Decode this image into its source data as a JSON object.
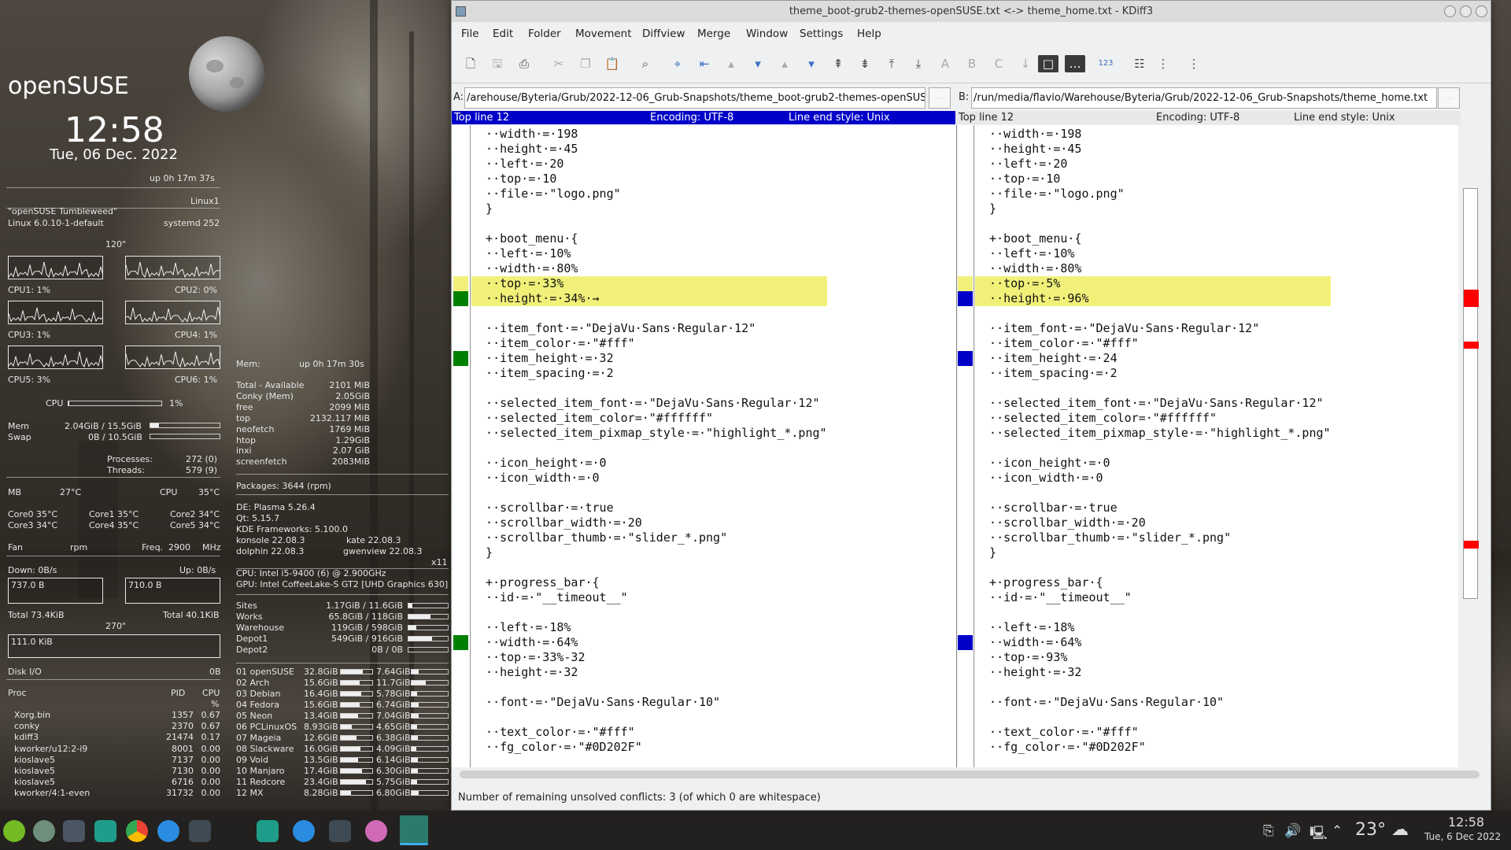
{
  "desktop": {
    "distro": "openSUSE",
    "clock": "12:58",
    "date": "Tue, 06 Dec. 2022",
    "uptime": "up  0h 17m 37s",
    "hostname": "Linux1",
    "os_name": "\"openSUSE Tumbleweed\"",
    "kernel": "Linux 6.0.10-1-default",
    "systemd": "systemd 252",
    "cpu_graph_label": "120\"",
    "cpus": [
      {
        "l": "CPU1: 1%",
        "r": "CPU2: 0%"
      },
      {
        "l": "CPU3: 1%",
        "r": "CPU4: 1%"
      },
      {
        "l": "CPU5: 3%",
        "r": "CPU6: 1%"
      }
    ],
    "cpu_total_label": "CPU",
    "cpu_total": "1%",
    "cpu_total_fraction": 0.01,
    "mem_label": "Mem",
    "mem_value": "2.04GiB / 15.5GiB",
    "mem_fraction": 0.13,
    "swap_label": "Swap",
    "swap_value": "0B / 10.5GiB",
    "swap_fraction": 0,
    "processes_label": "Processes:",
    "processes": "272 (0)",
    "threads_label": "Threads:",
    "threads": "579 (9)",
    "temps_header": {
      "mb": "MB",
      "mb_t": "27°C",
      "cpu": "CPU",
      "cpu_t": "35°C"
    },
    "cores": [
      [
        "Core0  35°C",
        "Core1  35°C",
        "Core2  34°C"
      ],
      [
        "Core3  34°C",
        "Core4  35°C",
        "Core5  34°C"
      ]
    ],
    "fan": "Fan",
    "rpm": "rpm",
    "freq_label": "Freq.",
    "freq": "2900",
    "mhz": "MHz",
    "down_label": "Down: 0B/s",
    "up_label": "Up: 0B/s",
    "down_peak": "737.0 B",
    "up_peak": "710.0 B",
    "total_down": "Total 73.4KiB",
    "total_up": "Total 40.1KiB",
    "net_graph_label": "270\"",
    "disk_peak": "111.0 KiB",
    "disk_io_label": "Disk I/O",
    "disk_io": "0B",
    "proc_header": {
      "name": "Proc",
      "pid": "PID",
      "cpu": "CPU",
      "pct": "%"
    },
    "procs": [
      {
        "name": "Xorg.bin",
        "pid": "1357",
        "cpu": "0.67"
      },
      {
        "name": "conky",
        "pid": "2370",
        "cpu": "0.67"
      },
      {
        "name": "kdiff3",
        "pid": "21474",
        "cpu": "0.17"
      },
      {
        "name": "kworker/u12:2-i9",
        "pid": "8001",
        "cpu": "0.00"
      },
      {
        "name": "kioslave5",
        "pid": "7137",
        "cpu": "0.00"
      },
      {
        "name": "kioslave5",
        "pid": "7130",
        "cpu": "0.00"
      },
      {
        "name": "kioslave5",
        "pid": "6716",
        "cpu": "0.00"
      },
      {
        "name": "kworker/4:1-even",
        "pid": "31732",
        "cpu": "0.00"
      }
    ],
    "mem2_label": "Mem:",
    "mem2_uptime": "up  0h 17m 30s",
    "memlist": [
      {
        "k": "Total - Available",
        "v": "2101 MiB"
      },
      {
        "k": "Conky (Mem)",
        "v": "2.05GiB"
      },
      {
        "k": "free",
        "v": "2099   MiB"
      },
      {
        "k": "top",
        "v": "2132.117  MiB"
      },
      {
        "k": "neofetch",
        "v": "1769 MiB"
      },
      {
        "k": "htop",
        "v": "1.29GiB"
      },
      {
        "k": "inxi",
        "v": "2.07 GiB"
      },
      {
        "k": "screenfetch",
        "v": "2083MiB"
      }
    ],
    "packages": "Packages: 3644 (rpm)",
    "de": "DE: Plasma 5.26.4",
    "qt": "Qt: 5.15.7",
    "kf": "KDE Frameworks: 5.100.0",
    "apps": [
      [
        "konsole 22.08.3",
        "kate 22.08.3"
      ],
      [
        "dolphin 22.08.3",
        "gwenview 22.08.3"
      ]
    ],
    "x11": "x11",
    "cpu_model": "CPU: Intel i5-9400 (6) @ 2.900GHz",
    "gpu_model": "GPU: Intel CoffeeLake-S GT2 [UHD Graphics 630]",
    "mounts": [
      {
        "n": "Sites",
        "v": "1.17GiB  /  11.6GiB",
        "f": 0.1
      },
      {
        "n": "Works",
        "v": "65.8GiB  /  118GiB",
        "f": 0.56
      },
      {
        "n": "Warehouse",
        "v": "119GiB  /  598GiB",
        "f": 0.2
      },
      {
        "n": "Depot1",
        "v": "549GiB  /  916GiB",
        "f": 0.6
      },
      {
        "n": "Depot2",
        "v": "0B  /   0B",
        "f": 0
      }
    ],
    "partitions": [
      {
        "n": "01 openSUSE",
        "a": "32.8GiB",
        "fa": 0.7,
        "b": "7.64GiB",
        "fb": 0.2
      },
      {
        "n": "02 Arch",
        "a": "15.6GiB",
        "fa": 0.6,
        "b": "11.7GiB",
        "fb": 0.4
      },
      {
        "n": "03 Debian",
        "a": "16.4GiB",
        "fa": 0.65,
        "b": "5.78GiB",
        "fb": 0.15
      },
      {
        "n": "04 Fedora",
        "a": "15.6GiB",
        "fa": 0.6,
        "b": "6.74GiB",
        "fb": 0.2
      },
      {
        "n": "05 Neon",
        "a": "13.4GiB",
        "fa": 0.55,
        "b": "7.04GiB",
        "fb": 0.2
      },
      {
        "n": "06 PCLinuxOS",
        "a": "8.93GiB",
        "fa": 0.35,
        "b": "4.65GiB",
        "fb": 0.15
      },
      {
        "n": "07 Mageia",
        "a": "12.6GiB",
        "fa": 0.5,
        "b": "6.38GiB",
        "fb": 0.18
      },
      {
        "n": "08 Slackware",
        "a": "16.0GiB",
        "fa": 0.62,
        "b": "4.09GiB",
        "fb": 0.12
      },
      {
        "n": "09 Void",
        "a": "13.5GiB",
        "fa": 0.55,
        "b": "6.14GiB",
        "fb": 0.18
      },
      {
        "n": "10 Manjaro",
        "a": "17.4GiB",
        "fa": 0.68,
        "b": "6.30GiB",
        "fb": 0.18
      },
      {
        "n": "11 Redcore",
        "a": "23.4GiB",
        "fa": 0.8,
        "b": "5.75GiB",
        "fb": 0.16
      },
      {
        "n": "12 MX",
        "a": "8.28GiB",
        "fa": 0.33,
        "b": "6.80GiB",
        "fb": 0.2
      }
    ]
  },
  "window": {
    "title": "theme_boot-grub2-themes-openSUSE.txt <-> theme_home.txt - KDiff3",
    "menu": [
      "File",
      "Edit",
      "Folder",
      "Movement",
      "Diffview",
      "Merge",
      "Window",
      "Settings",
      "Help"
    ],
    "a_label": "A:",
    "a_path": "/arehouse/Byteria/Grub/2022-12-06_Grub-Snapshots/theme_boot-grub2-themes-openSUSE.txt",
    "b_label": "B:",
    "b_path": "/run/media/flavio/Warehouse/Byteria/Grub/2022-12-06_Grub-Snapshots/theme_home.txt",
    "browse": "...",
    "a_status": {
      "top": "Top line 12",
      "enc": "Encoding: UTF-8",
      "eol": "Line end style: Unix"
    },
    "b_status": {
      "top": "Top line 12",
      "enc": "Encoding: UTF-8",
      "eol": "Line end style: Unix"
    },
    "statusbar": "Number of remaining unsolved conflicts: 3 (of which 0 are whitespace)",
    "colors": {
      "a_status_bg": "#0000c8",
      "conflict_yellow": "#f1f17a",
      "a_marker": "#008000",
      "b_marker": "#0000c8",
      "overview_red": "#ff0000"
    }
  },
  "diff_a": [
    "  ··width·=·198",
    "  ··height·=·45",
    "  ··left·=·20",
    "  ··top·=·10",
    "  ··file·=·\"logo.png\"",
    "  }",
    "",
    "  +·boot_menu·{",
    "  ··left·=·10%",
    "  ··width·=·80%",
    "  ··top·=·33%",
    "  ··height·=·34%·→",
    "",
    "  ··item_font·=·\"DejaVu·Sans·Regular·12\"",
    "  ··item_color·=·\"#fff\"",
    "  ··item_height·=·32",
    "  ··item_spacing·=·2",
    "",
    "  ··selected_item_font·=·\"DejaVu·Sans·Regular·12\"",
    "  ··selected_item_color=·\"#ffffff\"",
    "  ··selected_item_pixmap_style·=·\"highlight_*.png\"",
    "",
    "  ··icon_height·=·0",
    "  ··icon_width·=·0",
    "",
    "  ··scrollbar·=·true",
    "  ··scrollbar_width·=·20",
    "  ··scrollbar_thumb·=·\"slider_*.png\"",
    "  }",
    "",
    "  +·progress_bar·{",
    "  ··id·=·\"__timeout__\"",
    "",
    "  ··left·=·18%",
    "  ··width·=·64%",
    "  ··top·=·33%-32",
    "  ··height·=·32",
    "",
    "  ··font·=·\"DejaVu·Sans·Regular·10\"",
    "",
    "  ··text_color·=·\"#fff\"",
    "  ··fg_color·=·\"#0D202F\""
  ],
  "diff_b": [
    "  ··width·=·198",
    "  ··height·=·45",
    "  ··left·=·20",
    "  ··top·=·10",
    "  ··file·=·\"logo.png\"",
    "  }",
    "",
    "  +·boot_menu·{",
    "  ··left·=·10%",
    "  ··width·=·80%",
    "  ··top·=·5%",
    "  ··height·=·96%",
    "",
    "  ··item_font·=·\"DejaVu·Sans·Regular·12\"",
    "  ··item_color·=·\"#fff\"",
    "  ··item_height·=·24",
    "  ··item_spacing·=·2",
    "",
    "  ··selected_item_font·=·\"DejaVu·Sans·Regular·12\"",
    "  ··selected_item_color=·\"#ffffff\"",
    "  ··selected_item_pixmap_style·=·\"highlight_*.png\"",
    "",
    "  ··icon_height·=·0",
    "  ··icon_width·=·0",
    "",
    "  ··scrollbar·=·true",
    "  ··scrollbar_width·=·20",
    "  ··scrollbar_thumb·=·\"slider_*.png\"",
    "  }",
    "",
    "  +·progress_bar·{",
    "  ··id·=·\"__timeout__\"",
    "",
    "  ··left·=·18%",
    "  ··width·=·64%",
    "  ··top·=·93%",
    "  ··height·=·32",
    "",
    "  ··font·=·\"DejaVu·Sans·Regular·10\"",
    "",
    "  ··text_color·=·\"#fff\"",
    "  ··fg_color·=·\"#0D202F\""
  ],
  "diff_lines_changed": [
    10,
    11,
    15,
    34
  ],
  "taskbar": {
    "temp": "23°",
    "time": "12:58",
    "date": "Tue, 6 Dec 2022"
  }
}
